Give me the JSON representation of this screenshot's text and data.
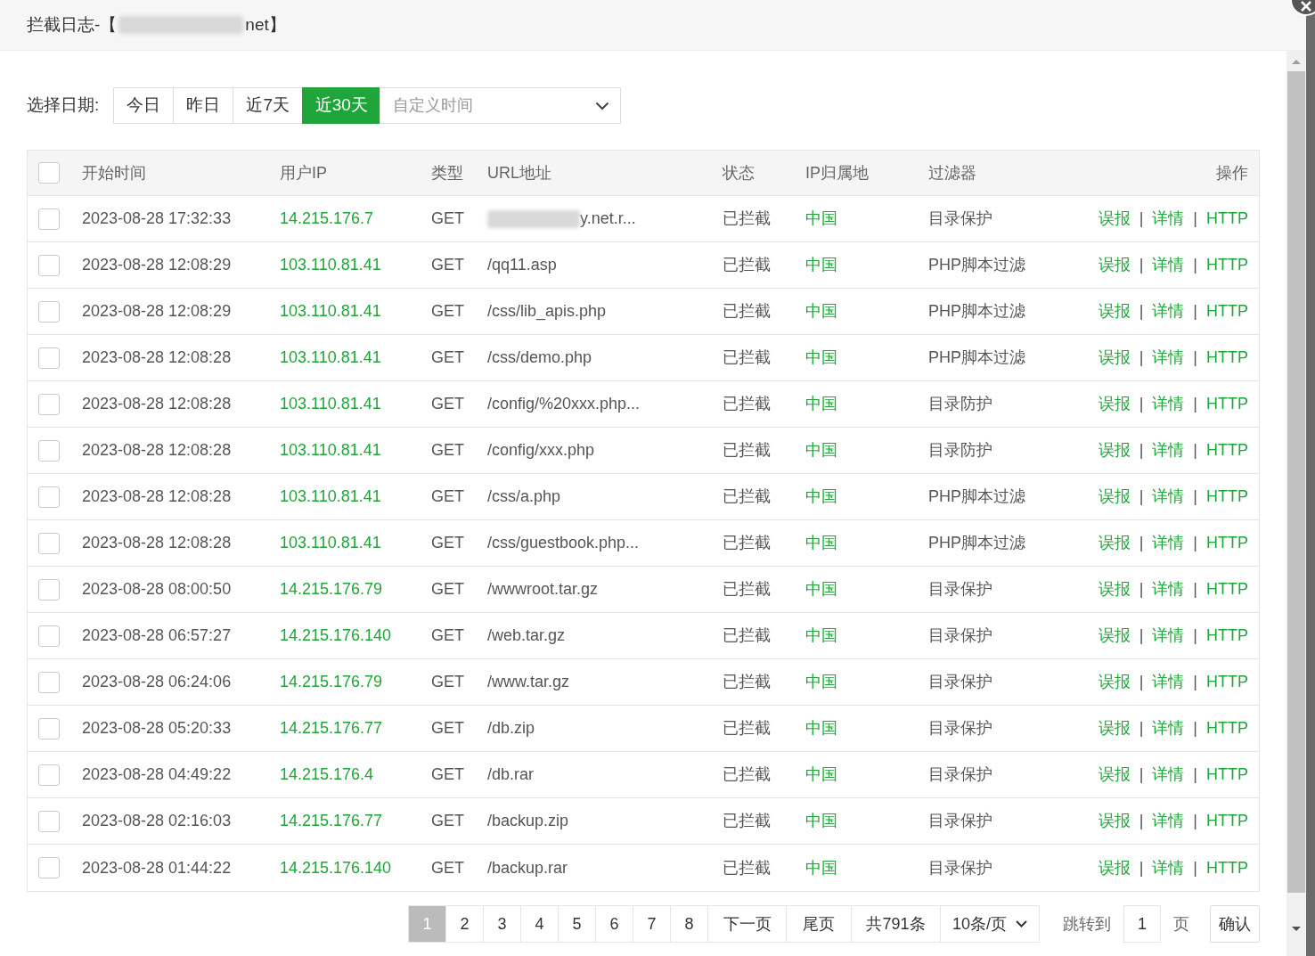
{
  "dialog": {
    "title_prefix": "拦截日志-【",
    "title_suffix": "net】",
    "title_redacted": true
  },
  "date_filter": {
    "label": "选择日期:",
    "options": [
      {
        "label": "今日",
        "selected": false
      },
      {
        "label": "昨日",
        "selected": false
      },
      {
        "label": "近7天",
        "selected": false
      },
      {
        "label": "近30天",
        "selected": true
      }
    ],
    "custom_placeholder": "自定义时间"
  },
  "table": {
    "select_all_checked": false,
    "columns": [
      "开始时间",
      "用户IP",
      "类型",
      "URL地址",
      "状态",
      "IP归属地",
      "过滤器",
      "操作"
    ],
    "rows": [
      {
        "checked": false,
        "time": "2023-08-28 17:32:33",
        "ip": "14.215.176.7",
        "type": "GET",
        "url": "y.net.r...",
        "url_redacted": true,
        "status": "已拦截",
        "location": "中国",
        "filter": "目录保护",
        "actions": [
          "误报",
          "详情",
          "HTTP"
        ]
      },
      {
        "checked": false,
        "time": "2023-08-28 12:08:29",
        "ip": "103.110.81.41",
        "type": "GET",
        "url": "/qq11.asp",
        "url_redacted": false,
        "status": "已拦截",
        "location": "中国",
        "filter": "PHP脚本过滤",
        "actions": [
          "误报",
          "详情",
          "HTTP"
        ]
      },
      {
        "checked": false,
        "time": "2023-08-28 12:08:29",
        "ip": "103.110.81.41",
        "type": "GET",
        "url": "/css/lib_apis.php",
        "url_redacted": false,
        "status": "已拦截",
        "location": "中国",
        "filter": "PHP脚本过滤",
        "actions": [
          "误报",
          "详情",
          "HTTP"
        ]
      },
      {
        "checked": false,
        "time": "2023-08-28 12:08:28",
        "ip": "103.110.81.41",
        "type": "GET",
        "url": "/css/demo.php",
        "url_redacted": false,
        "status": "已拦截",
        "location": "中国",
        "filter": "PHP脚本过滤",
        "actions": [
          "误报",
          "详情",
          "HTTP"
        ]
      },
      {
        "checked": false,
        "time": "2023-08-28 12:08:28",
        "ip": "103.110.81.41",
        "type": "GET",
        "url": "/config/%20xxx.php...",
        "url_redacted": false,
        "status": "已拦截",
        "location": "中国",
        "filter": "目录防护",
        "actions": [
          "误报",
          "详情",
          "HTTP"
        ]
      },
      {
        "checked": false,
        "time": "2023-08-28 12:08:28",
        "ip": "103.110.81.41",
        "type": "GET",
        "url": "/config/xxx.php",
        "url_redacted": false,
        "status": "已拦截",
        "location": "中国",
        "filter": "目录防护",
        "actions": [
          "误报",
          "详情",
          "HTTP"
        ]
      },
      {
        "checked": false,
        "time": "2023-08-28 12:08:28",
        "ip": "103.110.81.41",
        "type": "GET",
        "url": "/css/a.php",
        "url_redacted": false,
        "status": "已拦截",
        "location": "中国",
        "filter": "PHP脚本过滤",
        "actions": [
          "误报",
          "详情",
          "HTTP"
        ]
      },
      {
        "checked": false,
        "time": "2023-08-28 12:08:28",
        "ip": "103.110.81.41",
        "type": "GET",
        "url": "/css/guestbook.php...",
        "url_redacted": false,
        "status": "已拦截",
        "location": "中国",
        "filter": "PHP脚本过滤",
        "actions": [
          "误报",
          "详情",
          "HTTP"
        ]
      },
      {
        "checked": false,
        "time": "2023-08-28 08:00:50",
        "ip": "14.215.176.79",
        "type": "GET",
        "url": "/wwwroot.tar.gz",
        "url_redacted": false,
        "status": "已拦截",
        "location": "中国",
        "filter": "目录保护",
        "actions": [
          "误报",
          "详情",
          "HTTP"
        ]
      },
      {
        "checked": false,
        "time": "2023-08-28 06:57:27",
        "ip": "14.215.176.140",
        "type": "GET",
        "url": "/web.tar.gz",
        "url_redacted": false,
        "status": "已拦截",
        "location": "中国",
        "filter": "目录保护",
        "actions": [
          "误报",
          "详情",
          "HTTP"
        ]
      },
      {
        "checked": false,
        "time": "2023-08-28 06:24:06",
        "ip": "14.215.176.79",
        "type": "GET",
        "url": "/www.tar.gz",
        "url_redacted": false,
        "status": "已拦截",
        "location": "中国",
        "filter": "目录保护",
        "actions": [
          "误报",
          "详情",
          "HTTP"
        ]
      },
      {
        "checked": false,
        "time": "2023-08-28 05:20:33",
        "ip": "14.215.176.77",
        "type": "GET",
        "url": "/db.zip",
        "url_redacted": false,
        "status": "已拦截",
        "location": "中国",
        "filter": "目录保护",
        "actions": [
          "误报",
          "详情",
          "HTTP"
        ]
      },
      {
        "checked": false,
        "time": "2023-08-28 04:49:22",
        "ip": "14.215.176.4",
        "type": "GET",
        "url": "/db.rar",
        "url_redacted": false,
        "status": "已拦截",
        "location": "中国",
        "filter": "目录保护",
        "actions": [
          "误报",
          "详情",
          "HTTP"
        ]
      },
      {
        "checked": false,
        "time": "2023-08-28 02:16:03",
        "ip": "14.215.176.77",
        "type": "GET",
        "url": "/backup.zip",
        "url_redacted": false,
        "status": "已拦截",
        "location": "中国",
        "filter": "目录保护",
        "actions": [
          "误报",
          "详情",
          "HTTP"
        ]
      },
      {
        "checked": false,
        "time": "2023-08-28 01:44:22",
        "ip": "14.215.176.140",
        "type": "GET",
        "url": "/backup.rar",
        "url_redacted": false,
        "status": "已拦截",
        "location": "中国",
        "filter": "目录保护",
        "actions": [
          "误报",
          "详情",
          "HTTP"
        ]
      }
    ],
    "action_separator": "|"
  },
  "pagination": {
    "pages": [
      {
        "label": "1",
        "selected": true
      },
      {
        "label": "2",
        "selected": false
      },
      {
        "label": "3",
        "selected": false
      },
      {
        "label": "4",
        "selected": false
      },
      {
        "label": "5",
        "selected": false
      },
      {
        "label": "6",
        "selected": false
      },
      {
        "label": "7",
        "selected": false
      },
      {
        "label": "8",
        "selected": false
      }
    ],
    "next": "下一页",
    "last": "尾页",
    "total": "共791条",
    "page_size": "10条/页",
    "jump_label": "跳转到",
    "jump_value": "1",
    "page_unit": "页",
    "confirm": "确认"
  }
}
